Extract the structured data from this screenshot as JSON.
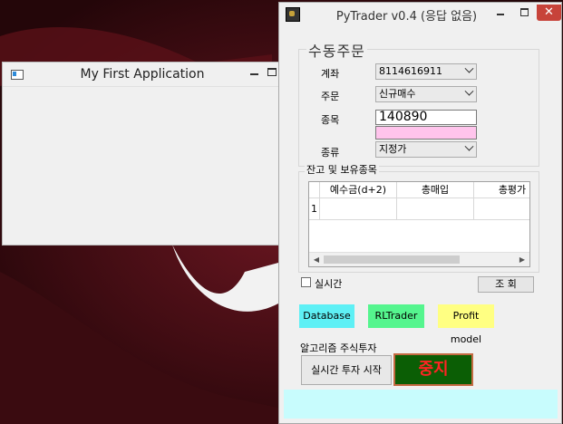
{
  "desktop": {
    "colors": {
      "background": "#2a0a0e",
      "ribbon": "#f2f2f2"
    }
  },
  "window1": {
    "title": "My First Application"
  },
  "pytrader": {
    "title": "PyTrader v0.4 (응답 없음)",
    "close_glyph": "✕",
    "manual_order": {
      "group_title": "수동주문",
      "account_label": "계좌",
      "account_value": "8114616911",
      "order_label": "주문",
      "order_value": "신규매수",
      "stock_label": "종목",
      "stock_code": "140890",
      "type_label": "종류",
      "type_value": "지정가"
    },
    "holdings": {
      "group_title": "잔고 및 보유종목",
      "columns": [
        "예수금(d+2)",
        "총매입",
        "총평가"
      ],
      "rows": [
        {
          "num": "1"
        }
      ]
    },
    "realtime_label": "실시간",
    "query_button": "조  회",
    "database_button": "Database",
    "rltrader_button": "RLTrader",
    "profit_button": "Profit model",
    "colors": {
      "database": "#5ef0f5",
      "rltrader": "#55f58e",
      "profit": "#ffff82",
      "stop_bg": "#0b5e05",
      "stop_text": "#ff2424",
      "status": "#c8fcfd"
    },
    "algo_label": "알고리즘 주식투자",
    "start_button": "실시간 투자 시작",
    "stop_button": "중지"
  }
}
